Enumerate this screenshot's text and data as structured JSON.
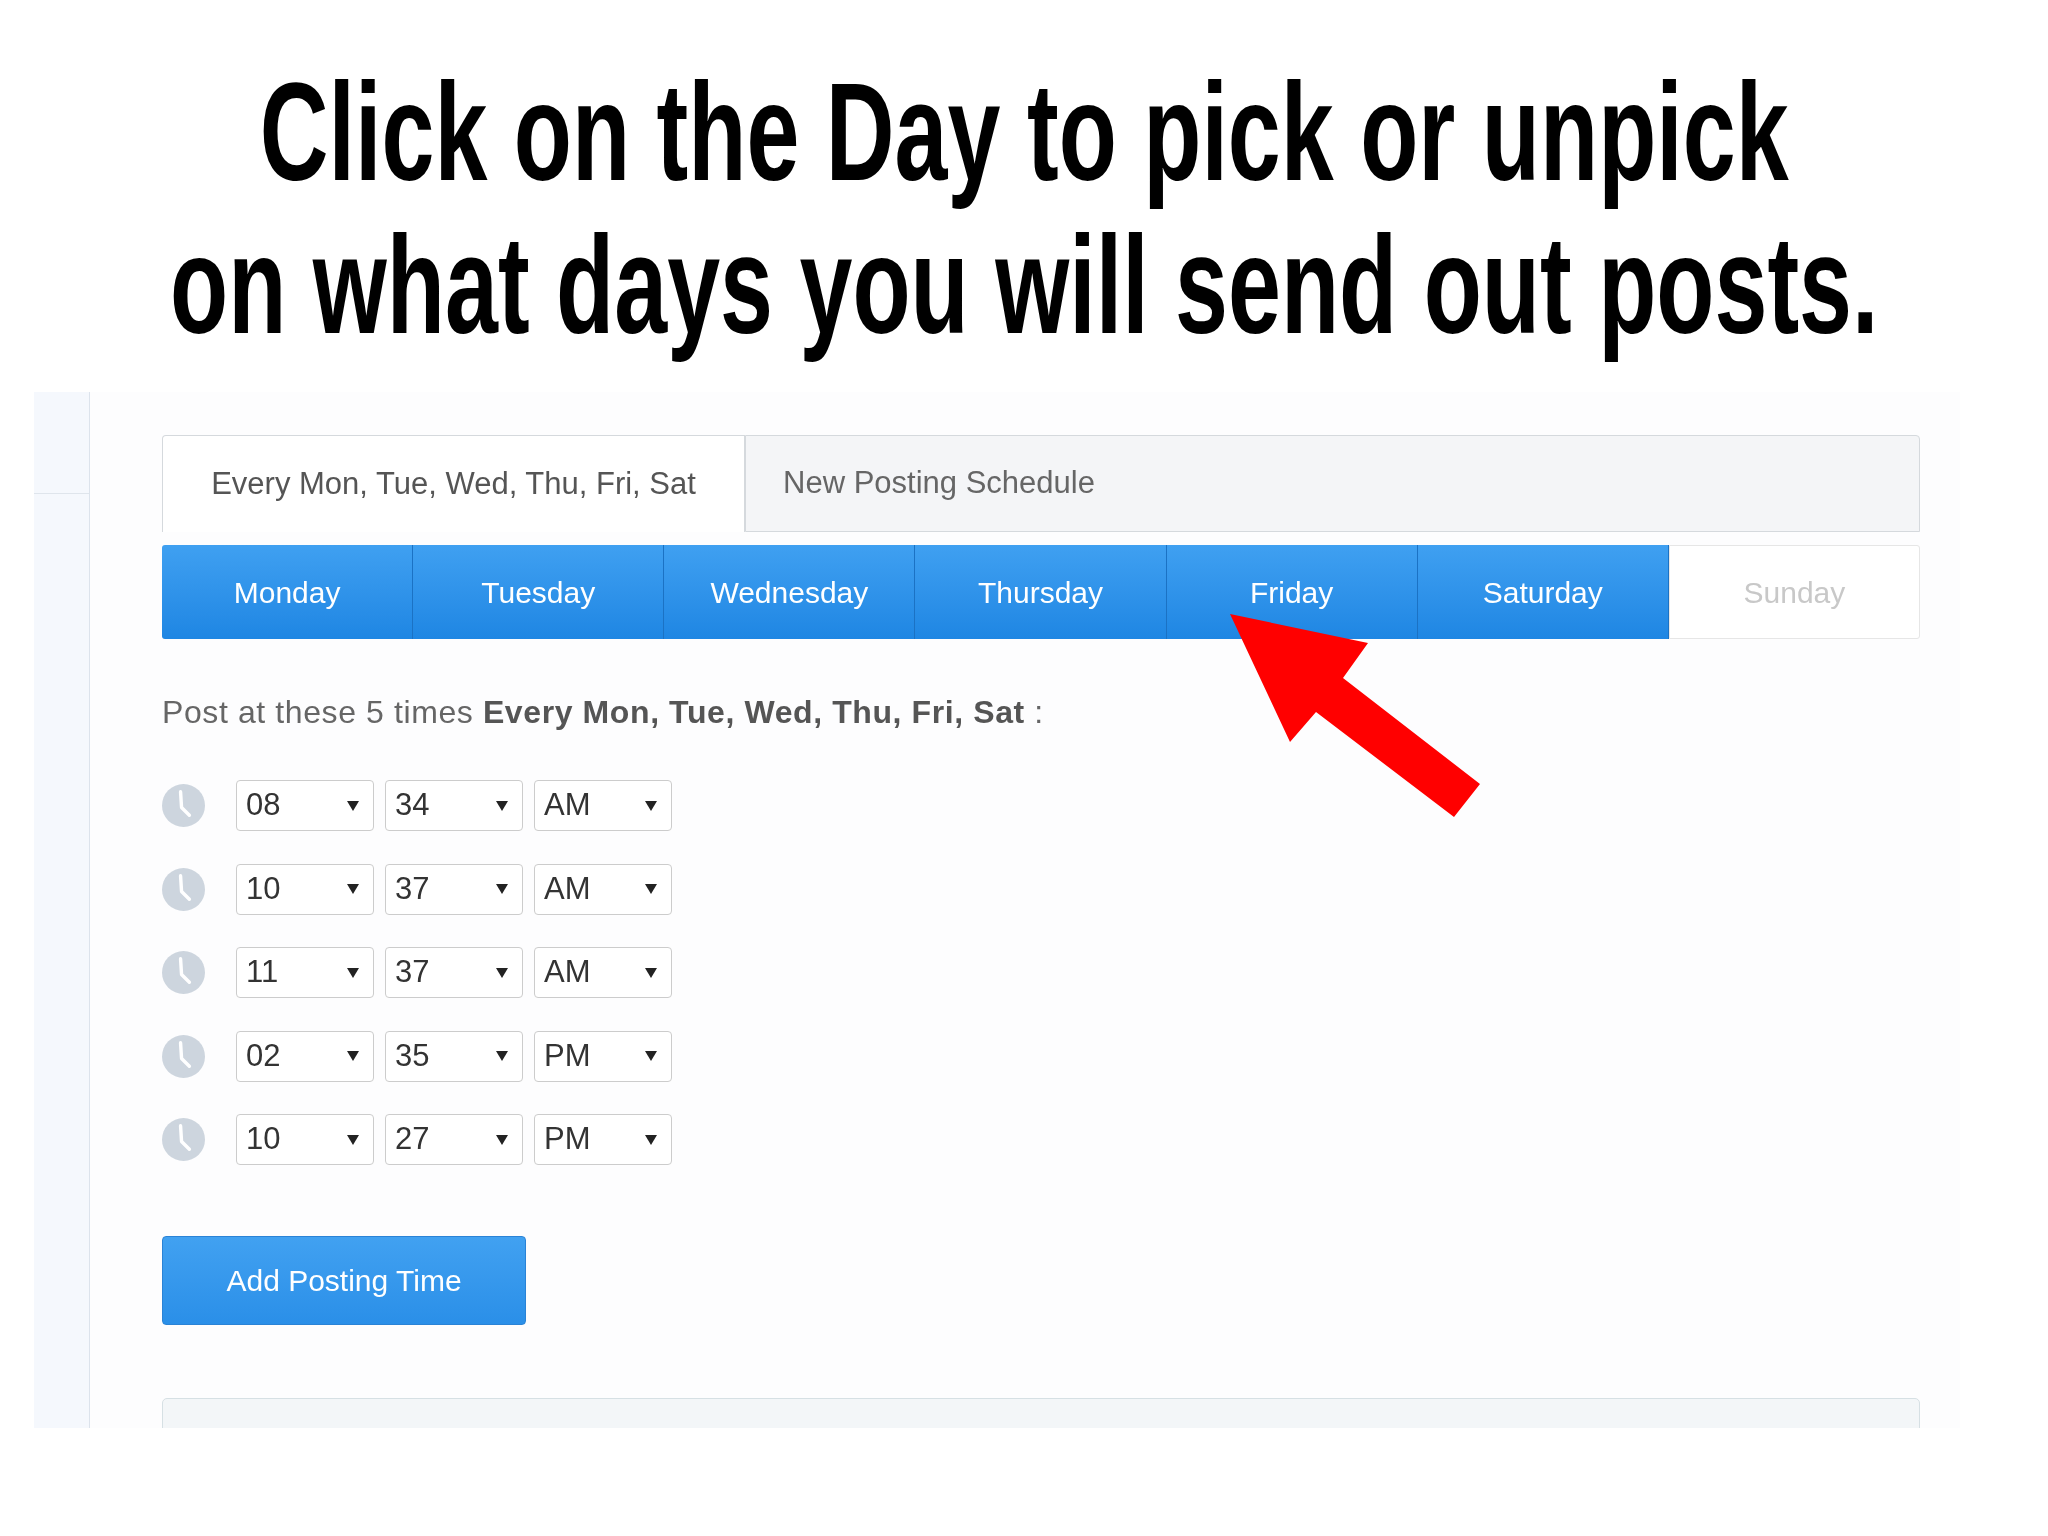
{
  "heading": {
    "lines": [
      "Click on the Day to pick or unpick",
      "on what days you will send out posts."
    ]
  },
  "schedule_tabs": [
    {
      "label": "Every Mon, Tue, Wed, Thu, Fri, Sat",
      "selected": true
    },
    {
      "label": "New Posting Schedule",
      "selected": false
    }
  ],
  "days": [
    {
      "label": "Monday",
      "selected": true
    },
    {
      "label": "Tuesday",
      "selected": true
    },
    {
      "label": "Wednesday",
      "selected": true
    },
    {
      "label": "Thursday",
      "selected": true
    },
    {
      "label": "Friday",
      "selected": true
    },
    {
      "label": "Saturday",
      "selected": true
    },
    {
      "label": "Sunday",
      "selected": false
    }
  ],
  "summary": "Post at these 5 times **Every Mon, Tue, Wed, Thu, Fri, Sat** :",
  "posting_times": [
    {
      "hour": "08",
      "minute": "34",
      "period": "AM"
    },
    {
      "hour": "10",
      "minute": "37",
      "period": "AM"
    },
    {
      "hour": "11",
      "minute": "37",
      "period": "AM"
    },
    {
      "hour": "02",
      "minute": "35",
      "period": "PM"
    },
    {
      "hour": "10",
      "minute": "27",
      "period": "PM"
    }
  ],
  "add_button": {
    "label": "Add Posting Time"
  }
}
